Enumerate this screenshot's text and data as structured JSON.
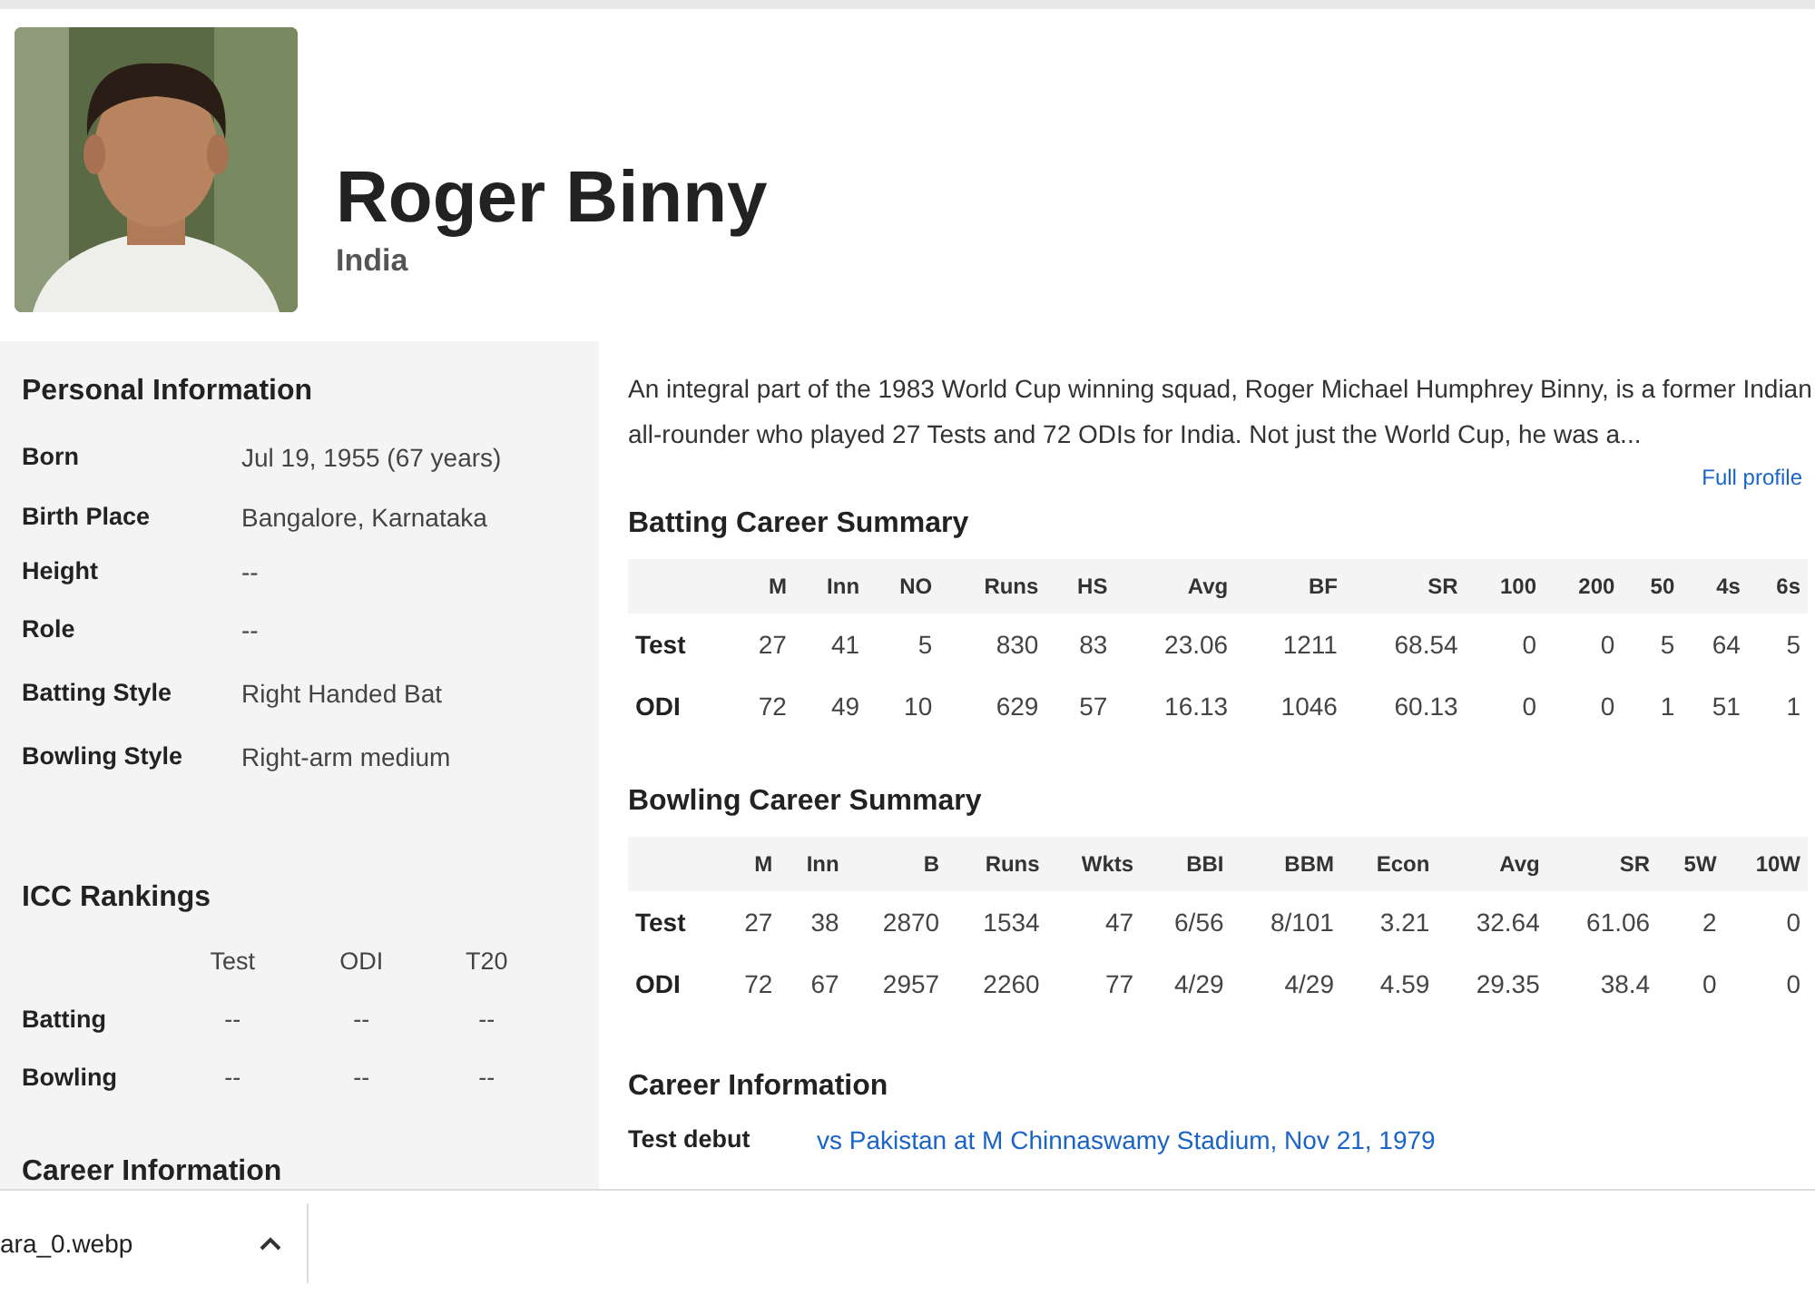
{
  "player": {
    "name": "Roger Binny",
    "country": "India"
  },
  "personal_info": {
    "title": "Personal Information",
    "rows": [
      {
        "label": "Born",
        "value": "Jul 19, 1955 (67 years)"
      },
      {
        "label": "Birth Place",
        "value": "Bangalore, Karnataka"
      },
      {
        "label": "Height",
        "value": "--"
      },
      {
        "label": "Role",
        "value": "--"
      },
      {
        "label": "Batting Style",
        "value": "Right Handed Bat"
      },
      {
        "label": "Bowling Style",
        "value": "Right-arm medium"
      }
    ]
  },
  "icc_rankings": {
    "title": "ICC Rankings",
    "columns": [
      "Test",
      "ODI",
      "T20"
    ],
    "rows": [
      {
        "label": "Batting",
        "values": [
          "--",
          "--",
          "--"
        ]
      },
      {
        "label": "Bowling",
        "values": [
          "--",
          "--",
          "--"
        ]
      }
    ]
  },
  "sidebar_career": {
    "title": "Career Information"
  },
  "summary": {
    "text": "An integral part of the 1983 World Cup winning squad, Roger Michael Humphrey Binny, is a former Indian all-rounder who played 27 Tests and 72 ODIs for India. Not just the World Cup, he was a...",
    "link": "Full profile"
  },
  "batting": {
    "title": "Batting Career Summary",
    "columns": [
      "M",
      "Inn",
      "NO",
      "Runs",
      "HS",
      "Avg",
      "BF",
      "SR",
      "100",
      "200",
      "50",
      "4s",
      "6s"
    ],
    "rows": [
      {
        "label": "Test",
        "values": [
          "27",
          "41",
          "5",
          "830",
          "83",
          "23.06",
          "1211",
          "68.54",
          "0",
          "0",
          "5",
          "64",
          "5"
        ]
      },
      {
        "label": "ODI",
        "values": [
          "72",
          "49",
          "10",
          "629",
          "57",
          "16.13",
          "1046",
          "60.13",
          "0",
          "0",
          "1",
          "51",
          "1"
        ]
      }
    ]
  },
  "bowling": {
    "title": "Bowling Career Summary",
    "columns": [
      "M",
      "Inn",
      "B",
      "Runs",
      "Wkts",
      "BBI",
      "BBM",
      "Econ",
      "Avg",
      "SR",
      "5W",
      "10W"
    ],
    "rows": [
      {
        "label": "Test",
        "values": [
          "27",
          "38",
          "2870",
          "1534",
          "47",
          "6/56",
          "8/101",
          "3.21",
          "32.64",
          "61.06",
          "2",
          "0"
        ]
      },
      {
        "label": "ODI",
        "values": [
          "72",
          "67",
          "2957",
          "2260",
          "77",
          "4/29",
          "4/29",
          "4.59",
          "29.35",
          "38.4",
          "0",
          "0"
        ]
      }
    ]
  },
  "career_info": {
    "title": "Career Information",
    "rows": [
      {
        "label": "Test debut",
        "value": "vs Pakistan at M Chinnaswamy Stadium, Nov 21, 1979"
      }
    ]
  },
  "download_bar": {
    "filename": "ara_0.webp"
  }
}
